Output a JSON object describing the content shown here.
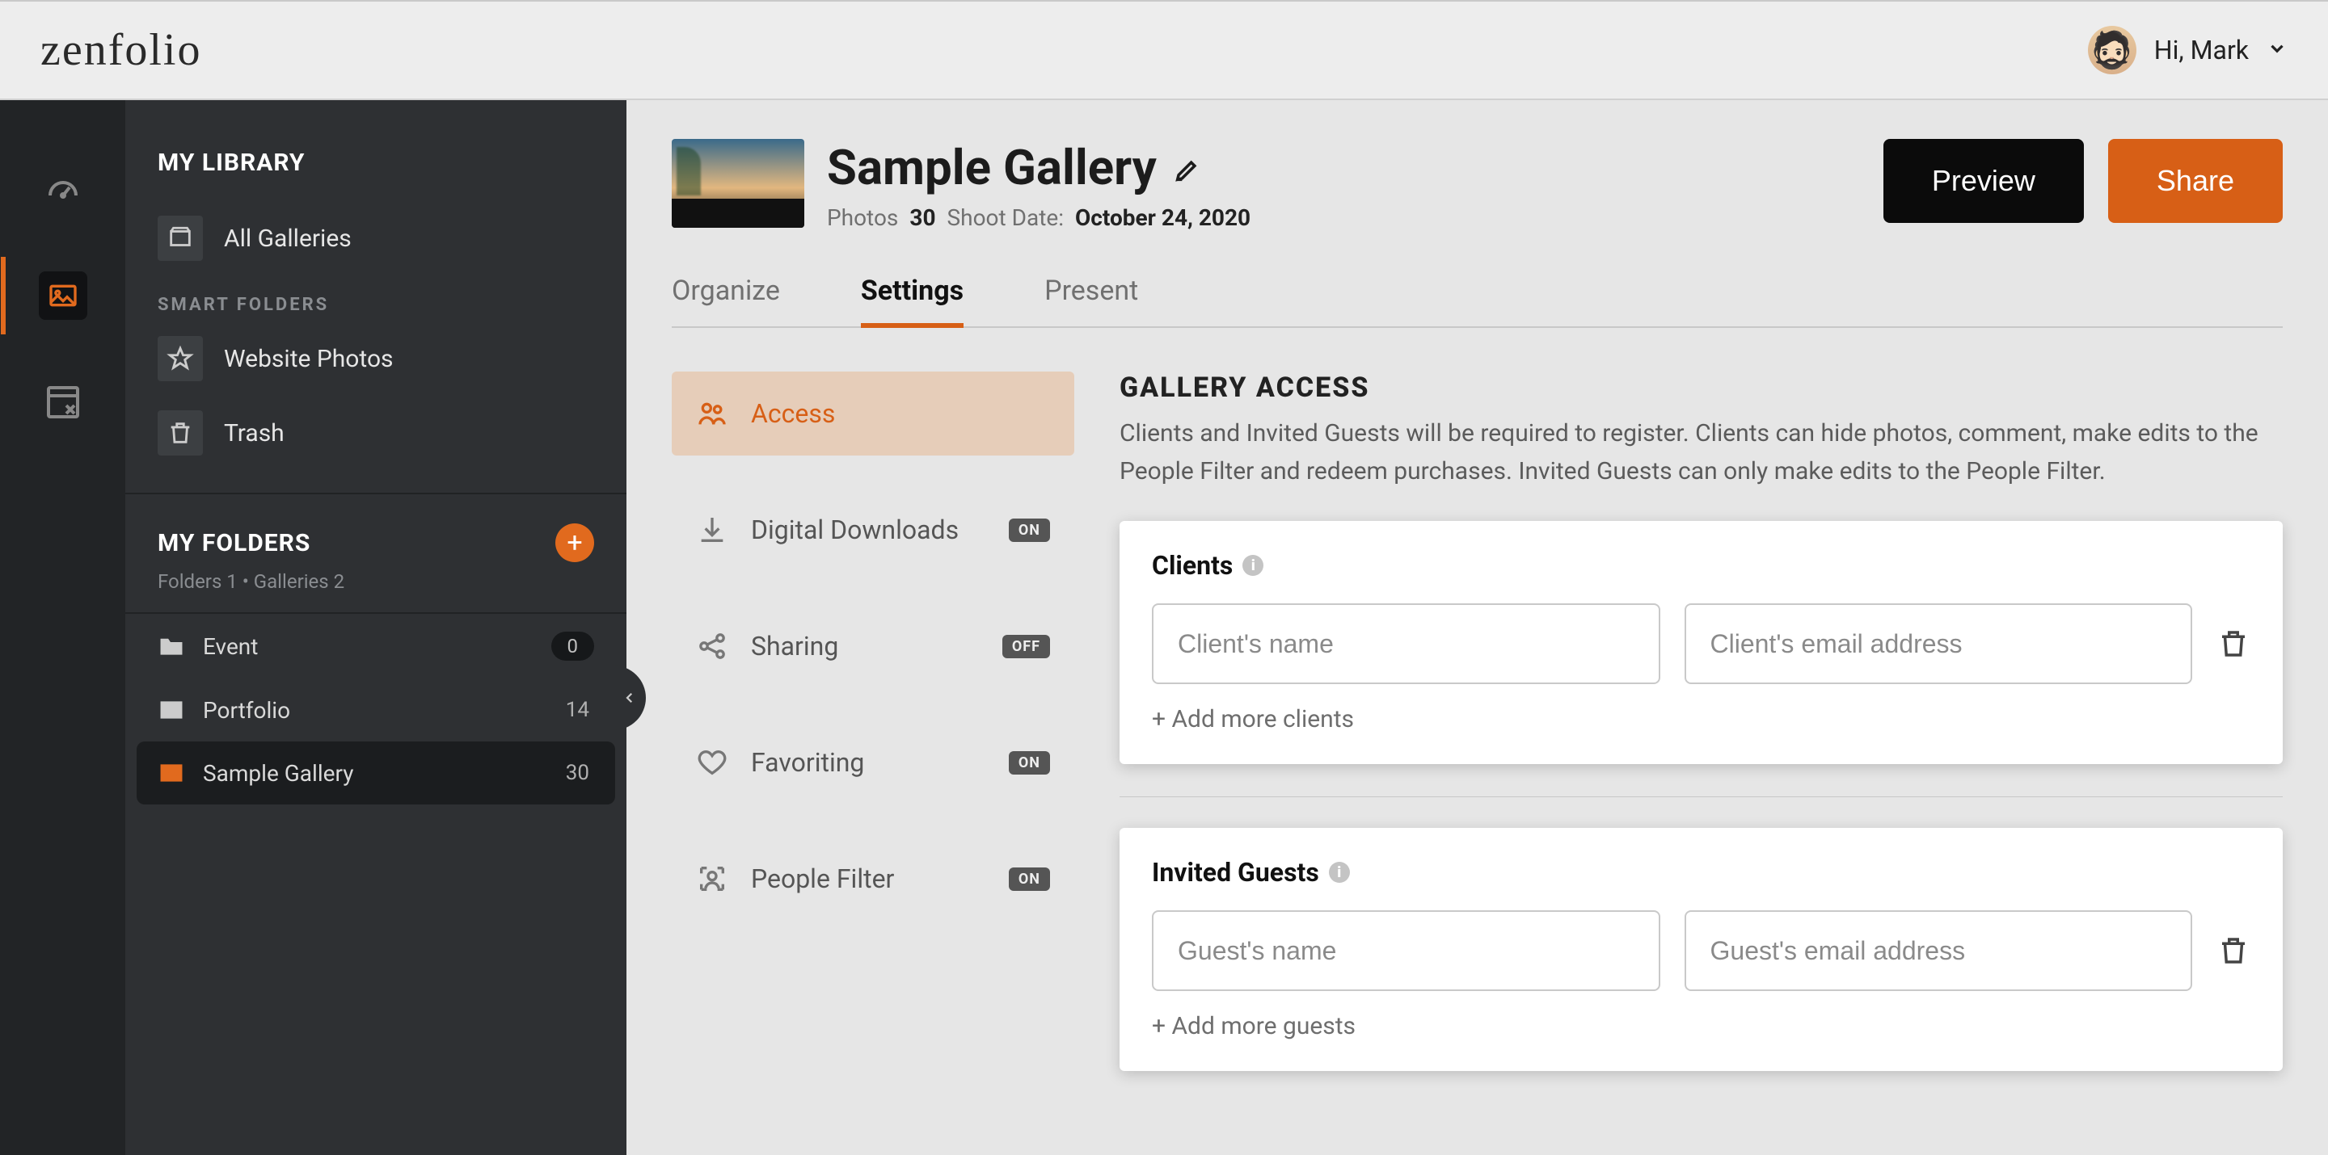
{
  "header": {
    "logo_text": "zenfolio",
    "greeting": "Hi, Mark"
  },
  "sidebar": {
    "library_title": "MY LIBRARY",
    "all_galleries": "All Galleries",
    "smart_folders_label": "SMART FOLDERS",
    "website_photos": "Website Photos",
    "trash": "Trash",
    "my_folders_title": "MY FOLDERS",
    "folders_sub": "Folders 1 • Galleries 2",
    "folders": [
      {
        "name": "Event",
        "count": "0",
        "pill": true
      },
      {
        "name": "Portfolio",
        "count": "14"
      },
      {
        "name": "Sample Gallery",
        "count": "30",
        "active": true
      }
    ]
  },
  "gallery": {
    "title": "Sample Gallery",
    "photos_label": "Photos",
    "photos_count": "30",
    "shoot_label": "Shoot Date:",
    "shoot_date": "October 24, 2020",
    "preview_btn": "Preview",
    "share_btn": "Share"
  },
  "tabs": {
    "organize": "Organize",
    "settings": "Settings",
    "present": "Present"
  },
  "settings_menu": {
    "access": "Access",
    "digital": "Digital Downloads",
    "sharing": "Sharing",
    "favoriting": "Favoriting",
    "people": "People Filter",
    "badges": {
      "digital": "ON",
      "sharing": "OFF",
      "favoriting": "ON",
      "people": "ON"
    }
  },
  "access": {
    "title": "GALLERY ACCESS",
    "desc": "Clients and Invited Guests will be required to register. Clients can hide photos, comment, make edits to the People Filter and redeem purchases. Invited Guests can only make edits to the People Filter.",
    "clients_label": "Clients",
    "clients_name_ph": "Client's name",
    "clients_email_ph": "Client's email address",
    "add_clients": "+ Add more clients",
    "guests_label": "Invited Guests",
    "guests_name_ph": "Guest's name",
    "guests_email_ph": "Guest's email address",
    "add_guests": "+ Add more guests"
  }
}
